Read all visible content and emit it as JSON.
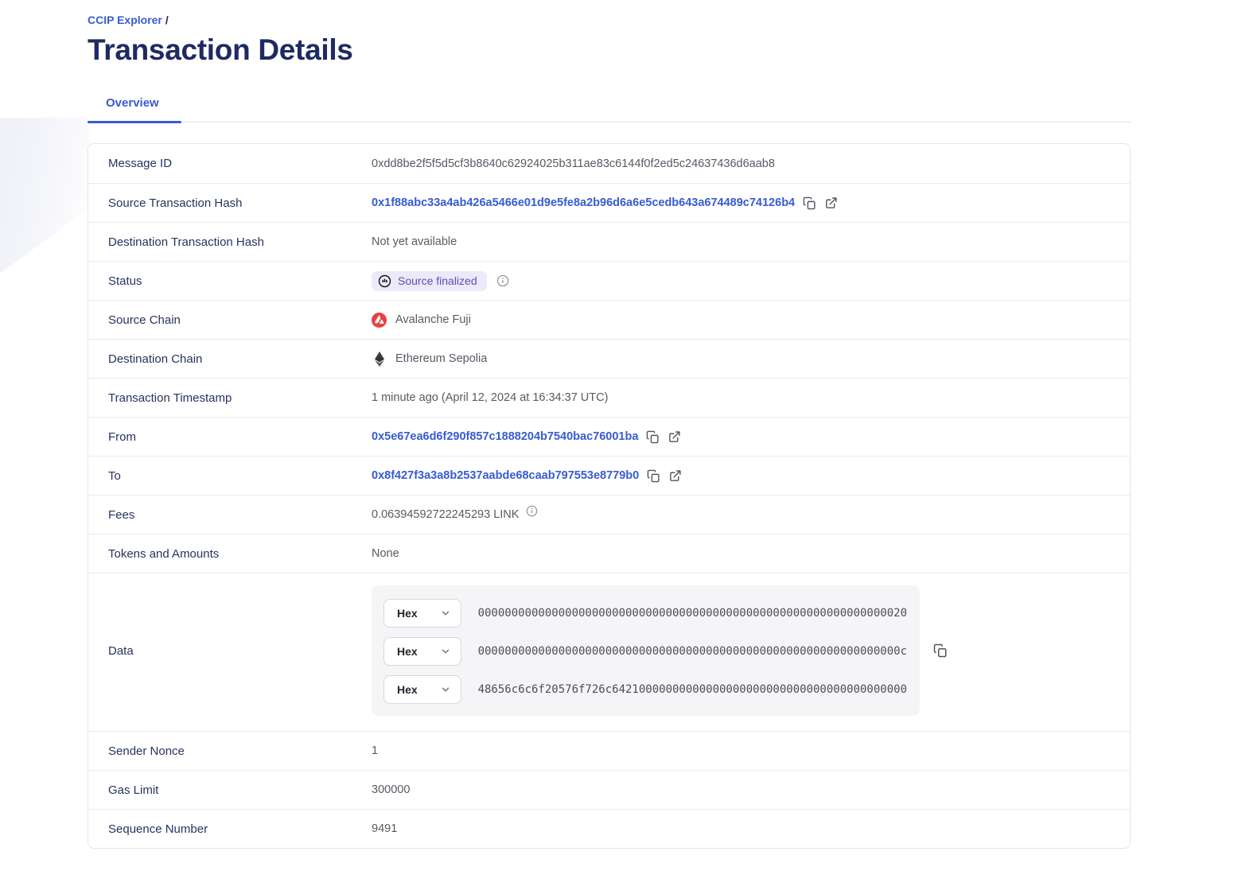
{
  "page": {
    "breadcrumb": {
      "link_label": "CCIP Explorer",
      "separator": "/"
    },
    "title": "Transaction Details",
    "tab_label": "Overview"
  },
  "colors": {
    "accent_blue": "#375BD2",
    "heading_navy": "#1e2a63",
    "badge_bg": "#ece9f9",
    "badge_text": "#5b51ad",
    "avalanche_red": "#E84142",
    "ethereum_dark": "#2b2b2b"
  },
  "table": {
    "rows": {
      "message_id": {
        "label": "Message ID",
        "value": "0xdd8be2f5f5d5cf3b8640c62924025b311ae83c6144f0f2ed5c24637436d6aab8"
      },
      "source_tx_hash": {
        "label": "Source Transaction Hash",
        "value": "0x1f88abc33a4ab426a5466e01d9e5fe8a2b96d6a6e5cedb643a674489c74126b4"
      },
      "dest_tx_hash": {
        "label": "Destination Transaction Hash",
        "value": "Not yet available"
      },
      "status": {
        "label": "Status",
        "value": "Source finalized"
      },
      "source_chain": {
        "label": "Source Chain",
        "value": "Avalanche Fuji"
      },
      "dest_chain": {
        "label": "Destination Chain",
        "value": "Ethereum Sepolia"
      },
      "timestamp": {
        "label": "Transaction Timestamp",
        "value": "1 minute ago (April 12, 2024 at 16:34:37 UTC)"
      },
      "from": {
        "label": "From",
        "value": "0x5e67ea6d6f290f857c1888204b7540bac76001ba"
      },
      "to": {
        "label": "To",
        "value": "0x8f427f3a3a8b2537aabde68caab797553e8779b0"
      },
      "fees": {
        "label": "Fees",
        "value": "0.06394592722245293 LINK"
      },
      "tokens": {
        "label": "Tokens and Amounts",
        "value": "None"
      },
      "data": {
        "label": "Data",
        "format": "Hex",
        "lines": [
          "0000000000000000000000000000000000000000000000000000000000000020",
          "000000000000000000000000000000000000000000000000000000000000000c",
          "48656c6c6f20576f726c64210000000000000000000000000000000000000000"
        ]
      },
      "sender_nonce": {
        "label": "Sender Nonce",
        "value": "1"
      },
      "gas_limit": {
        "label": "Gas Limit",
        "value": "300000"
      },
      "sequence_number": {
        "label": "Sequence Number",
        "value": "9491"
      }
    }
  }
}
